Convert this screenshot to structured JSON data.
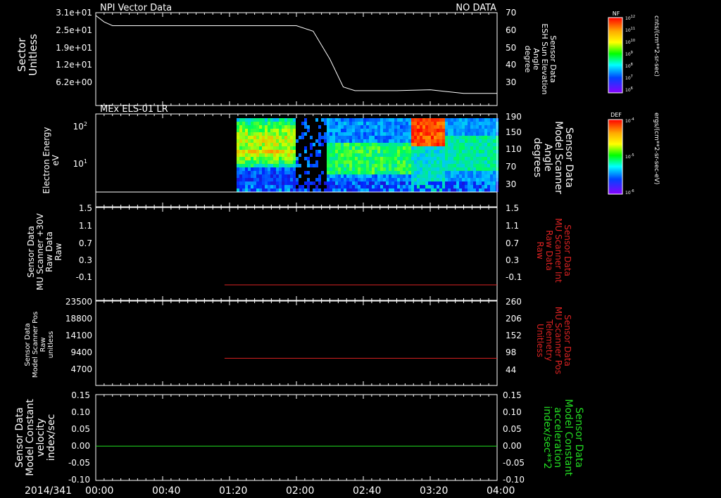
{
  "date_label": "2014/341",
  "time_ticks": [
    "00:00",
    "00:40",
    "01:20",
    "02:00",
    "02:40",
    "03:20",
    "04:00"
  ],
  "colors": {
    "white": "#ffffff",
    "red": "#dd2222",
    "green": "#22dd22",
    "background": "#000000"
  },
  "panels": [
    {
      "id": "sector",
      "title_left": "NPI Vector Data",
      "title_right": "NO DATA",
      "left_label": [
        "Sector",
        "Unitless"
      ],
      "left_ticks": [
        "3.1e+01",
        "2.5e+01",
        "1.9e+01",
        "1.2e+01",
        "6.2e+00"
      ],
      "right_label": [
        "Sensor Data",
        "ESH Sun Elevation",
        "Angle",
        "degree"
      ],
      "right_ticks": [
        "70",
        "60",
        "50",
        "40",
        "30"
      ],
      "right_color": "white"
    },
    {
      "id": "els",
      "title_left": "MEx ELS-01 LR",
      "left_label": [
        "Electron Energy",
        "eV"
      ],
      "left_ticks": [
        "10",
        "10"
      ],
      "left_tick_exps": [
        "2",
        "1"
      ],
      "right_label": [
        "Sensor Data",
        "Model Scanner",
        "Angle",
        "degrees"
      ],
      "right_ticks": [
        "190",
        "150",
        "110",
        "70",
        "30"
      ],
      "right_color": "white"
    },
    {
      "id": "mu-int",
      "left_label": [
        "Sensor Data",
        "MU Scanner +30V",
        "Raw Data",
        "Raw"
      ],
      "left_ticks": [
        "1.5",
        "1.1",
        "0.7",
        "0.3",
        "-0.1"
      ],
      "right_label": [
        "Sensor Data",
        "MU Scanner Int",
        "Raw Data",
        "Raw"
      ],
      "right_ticks": [
        "1.5",
        "1.1",
        "0.7",
        "0.3",
        "-0.1"
      ],
      "right_color": "red"
    },
    {
      "id": "mu-pos",
      "left_label": [
        "Sensor Data",
        "Model Scanner Pos",
        "Raw",
        "unitless"
      ],
      "left_ticks": [
        "23500",
        "18800",
        "14100",
        "9400",
        "4700"
      ],
      "right_label": [
        "Sensor Data",
        "MU Scanner Pos",
        "Telemetry",
        "Unitless"
      ],
      "right_ticks": [
        "260",
        "206",
        "152",
        "98",
        "44"
      ],
      "right_color": "red"
    },
    {
      "id": "velocity",
      "left_label": [
        "Sensor Data",
        "Model Constant",
        "velocity",
        "index/sec"
      ],
      "left_ticks": [
        "0.15",
        "0.10",
        "0.05",
        "0.00",
        "-0.05",
        "-0.10"
      ],
      "right_label": [
        "Sensor Data",
        "Model Constant",
        "acceleration",
        "index/sec**2"
      ],
      "right_ticks": [
        "0.15",
        "0.10",
        "0.05",
        "0.00",
        "-0.05",
        "-0.10"
      ],
      "right_color": "green"
    }
  ],
  "colorbars": [
    {
      "label": "NF",
      "unit": "cnts/(cm**2-sr-sec)",
      "ticks": [
        "10",
        "10",
        "10",
        "10",
        "10",
        "10",
        "10"
      ],
      "tick_exps": [
        "12",
        "11",
        "10",
        "9",
        "8",
        "7",
        "6"
      ]
    },
    {
      "label": "DEF",
      "unit": "ergs/(cm**2-sr-sec-eV)",
      "ticks": [
        "10",
        "10",
        "10"
      ],
      "tick_exps": [
        "-4",
        "-5",
        "-6"
      ]
    }
  ],
  "chart_data": [
    {
      "type": "line",
      "panel": "sector",
      "series": [
        {
          "name": "ESH Sun Elevation",
          "color": "white",
          "axis": "right",
          "x": [
            "00:00",
            "00:05",
            "00:10",
            "00:20",
            "00:40",
            "01:20",
            "02:00",
            "02:10",
            "02:20",
            "02:28",
            "02:35",
            "02:40",
            "03:00",
            "03:20",
            "03:30",
            "03:40",
            "04:00"
          ],
          "y": [
            68.5,
            65,
            63,
            63,
            63,
            63,
            63,
            60,
            45,
            30,
            28,
            28,
            28,
            28.5,
            27.5,
            26.5,
            26.5
          ]
        }
      ],
      "ylim_right": [
        20,
        70
      ]
    },
    {
      "type": "heatmap",
      "panel": "els",
      "description_x_start": "01:20",
      "ylabel": "Electron Energy eV",
      "log_y": true,
      "horizontal_line_eV": 1.9
    },
    {
      "type": "line",
      "panel": "mu-int",
      "series": [
        {
          "color": "red",
          "axis": "right",
          "x": [
            "01:17",
            "04:00"
          ],
          "y": [
            0.0,
            0.0
          ]
        }
      ],
      "ylim": [
        -0.3,
        1.5
      ]
    },
    {
      "type": "line",
      "panel": "mu-pos",
      "series": [
        {
          "color": "red",
          "axis": "right",
          "x": [
            "01:17",
            "04:00"
          ],
          "y": [
            89,
            89
          ]
        }
      ],
      "ylim_right": [
        8,
        260
      ]
    },
    {
      "type": "line",
      "panel": "velocity",
      "series": [
        {
          "color": "green",
          "axis": "left",
          "x": [
            "00:00",
            "04:00"
          ],
          "y": [
            0.0,
            0.0
          ]
        }
      ],
      "ylim": [
        -0.1,
        0.15
      ]
    }
  ]
}
